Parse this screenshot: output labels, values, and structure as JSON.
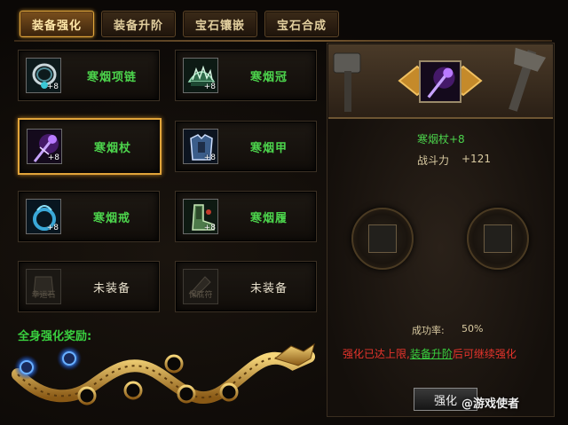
{
  "tabs": [
    {
      "label": "装备强化",
      "active": true
    },
    {
      "label": "装备升阶",
      "active": false
    },
    {
      "label": "宝石镶嵌",
      "active": false
    },
    {
      "label": "宝石合成",
      "active": false
    }
  ],
  "equipment": [
    {
      "name": "寒烟项链",
      "level": "+8",
      "icon": "necklace-icon",
      "selected": false
    },
    {
      "name": "寒烟冠",
      "level": "+8",
      "icon": "helmet-icon",
      "selected": false
    },
    {
      "name": "寒烟杖",
      "level": "+8",
      "icon": "staff-icon",
      "selected": true
    },
    {
      "name": "寒烟甲",
      "level": "+8",
      "icon": "armor-icon",
      "selected": false
    },
    {
      "name": "寒烟戒",
      "level": "+8",
      "icon": "ring-icon",
      "selected": false
    },
    {
      "name": "寒烟履",
      "level": "+8",
      "icon": "boots-icon",
      "selected": false
    },
    {
      "name": "未装备",
      "slot_hint": "幸运石",
      "icon": "lucky-stone-icon",
      "selected": false
    },
    {
      "name": "未装备",
      "slot_hint": "保底符",
      "icon": "guarantee-charm-icon",
      "selected": false
    }
  ],
  "bonus": {
    "title": "全身强化奖励:"
  },
  "detail": {
    "item_name": "寒烟杖+8",
    "power_label": "战斗力",
    "power_value": "+121",
    "success_label": "成功率:",
    "success_value": "50%",
    "message_prefix": "强化已达上限,",
    "message_link": "装备升阶",
    "message_suffix": "后可继续强化"
  },
  "action": {
    "strengthen_label": "强化"
  },
  "watermark": {
    "text": "@游戏使者"
  },
  "colors": {
    "accent_gold": "#e1a43a",
    "item_green": "#4cd44c",
    "warning_red": "#e8342c"
  }
}
